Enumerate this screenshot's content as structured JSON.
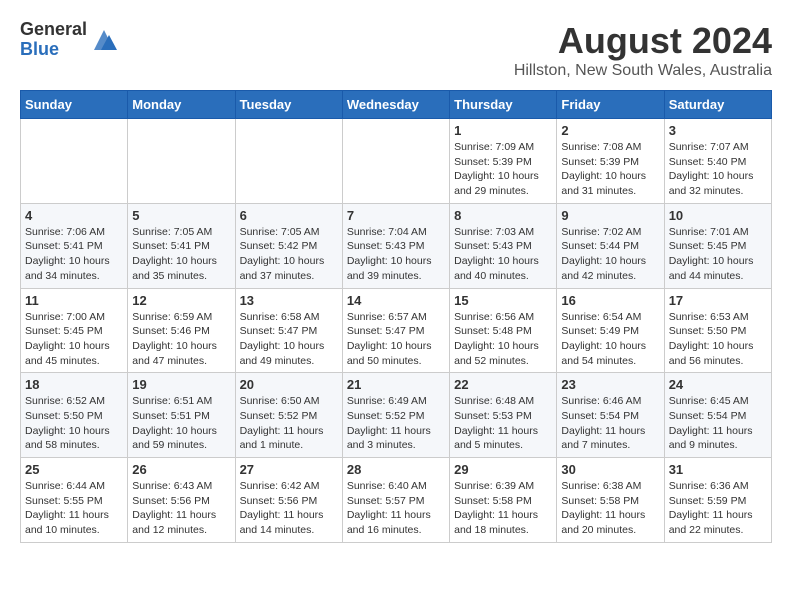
{
  "logo": {
    "general": "General",
    "blue": "Blue"
  },
  "title": "August 2024",
  "subtitle": "Hillston, New South Wales, Australia",
  "days_of_week": [
    "Sunday",
    "Monday",
    "Tuesday",
    "Wednesday",
    "Thursday",
    "Friday",
    "Saturday"
  ],
  "weeks": [
    [
      {
        "day": "",
        "info": ""
      },
      {
        "day": "",
        "info": ""
      },
      {
        "day": "",
        "info": ""
      },
      {
        "day": "",
        "info": ""
      },
      {
        "day": "1",
        "info": "Sunrise: 7:09 AM\nSunset: 5:39 PM\nDaylight: 10 hours\nand 29 minutes."
      },
      {
        "day": "2",
        "info": "Sunrise: 7:08 AM\nSunset: 5:39 PM\nDaylight: 10 hours\nand 31 minutes."
      },
      {
        "day": "3",
        "info": "Sunrise: 7:07 AM\nSunset: 5:40 PM\nDaylight: 10 hours\nand 32 minutes."
      }
    ],
    [
      {
        "day": "4",
        "info": "Sunrise: 7:06 AM\nSunset: 5:41 PM\nDaylight: 10 hours\nand 34 minutes."
      },
      {
        "day": "5",
        "info": "Sunrise: 7:05 AM\nSunset: 5:41 PM\nDaylight: 10 hours\nand 35 minutes."
      },
      {
        "day": "6",
        "info": "Sunrise: 7:05 AM\nSunset: 5:42 PM\nDaylight: 10 hours\nand 37 minutes."
      },
      {
        "day": "7",
        "info": "Sunrise: 7:04 AM\nSunset: 5:43 PM\nDaylight: 10 hours\nand 39 minutes."
      },
      {
        "day": "8",
        "info": "Sunrise: 7:03 AM\nSunset: 5:43 PM\nDaylight: 10 hours\nand 40 minutes."
      },
      {
        "day": "9",
        "info": "Sunrise: 7:02 AM\nSunset: 5:44 PM\nDaylight: 10 hours\nand 42 minutes."
      },
      {
        "day": "10",
        "info": "Sunrise: 7:01 AM\nSunset: 5:45 PM\nDaylight: 10 hours\nand 44 minutes."
      }
    ],
    [
      {
        "day": "11",
        "info": "Sunrise: 7:00 AM\nSunset: 5:45 PM\nDaylight: 10 hours\nand 45 minutes."
      },
      {
        "day": "12",
        "info": "Sunrise: 6:59 AM\nSunset: 5:46 PM\nDaylight: 10 hours\nand 47 minutes."
      },
      {
        "day": "13",
        "info": "Sunrise: 6:58 AM\nSunset: 5:47 PM\nDaylight: 10 hours\nand 49 minutes."
      },
      {
        "day": "14",
        "info": "Sunrise: 6:57 AM\nSunset: 5:47 PM\nDaylight: 10 hours\nand 50 minutes."
      },
      {
        "day": "15",
        "info": "Sunrise: 6:56 AM\nSunset: 5:48 PM\nDaylight: 10 hours\nand 52 minutes."
      },
      {
        "day": "16",
        "info": "Sunrise: 6:54 AM\nSunset: 5:49 PM\nDaylight: 10 hours\nand 54 minutes."
      },
      {
        "day": "17",
        "info": "Sunrise: 6:53 AM\nSunset: 5:50 PM\nDaylight: 10 hours\nand 56 minutes."
      }
    ],
    [
      {
        "day": "18",
        "info": "Sunrise: 6:52 AM\nSunset: 5:50 PM\nDaylight: 10 hours\nand 58 minutes."
      },
      {
        "day": "19",
        "info": "Sunrise: 6:51 AM\nSunset: 5:51 PM\nDaylight: 10 hours\nand 59 minutes."
      },
      {
        "day": "20",
        "info": "Sunrise: 6:50 AM\nSunset: 5:52 PM\nDaylight: 11 hours\nand 1 minute."
      },
      {
        "day": "21",
        "info": "Sunrise: 6:49 AM\nSunset: 5:52 PM\nDaylight: 11 hours\nand 3 minutes."
      },
      {
        "day": "22",
        "info": "Sunrise: 6:48 AM\nSunset: 5:53 PM\nDaylight: 11 hours\nand 5 minutes."
      },
      {
        "day": "23",
        "info": "Sunrise: 6:46 AM\nSunset: 5:54 PM\nDaylight: 11 hours\nand 7 minutes."
      },
      {
        "day": "24",
        "info": "Sunrise: 6:45 AM\nSunset: 5:54 PM\nDaylight: 11 hours\nand 9 minutes."
      }
    ],
    [
      {
        "day": "25",
        "info": "Sunrise: 6:44 AM\nSunset: 5:55 PM\nDaylight: 11 hours\nand 10 minutes."
      },
      {
        "day": "26",
        "info": "Sunrise: 6:43 AM\nSunset: 5:56 PM\nDaylight: 11 hours\nand 12 minutes."
      },
      {
        "day": "27",
        "info": "Sunrise: 6:42 AM\nSunset: 5:56 PM\nDaylight: 11 hours\nand 14 minutes."
      },
      {
        "day": "28",
        "info": "Sunrise: 6:40 AM\nSunset: 5:57 PM\nDaylight: 11 hours\nand 16 minutes."
      },
      {
        "day": "29",
        "info": "Sunrise: 6:39 AM\nSunset: 5:58 PM\nDaylight: 11 hours\nand 18 minutes."
      },
      {
        "day": "30",
        "info": "Sunrise: 6:38 AM\nSunset: 5:58 PM\nDaylight: 11 hours\nand 20 minutes."
      },
      {
        "day": "31",
        "info": "Sunrise: 6:36 AM\nSunset: 5:59 PM\nDaylight: 11 hours\nand 22 minutes."
      }
    ]
  ]
}
